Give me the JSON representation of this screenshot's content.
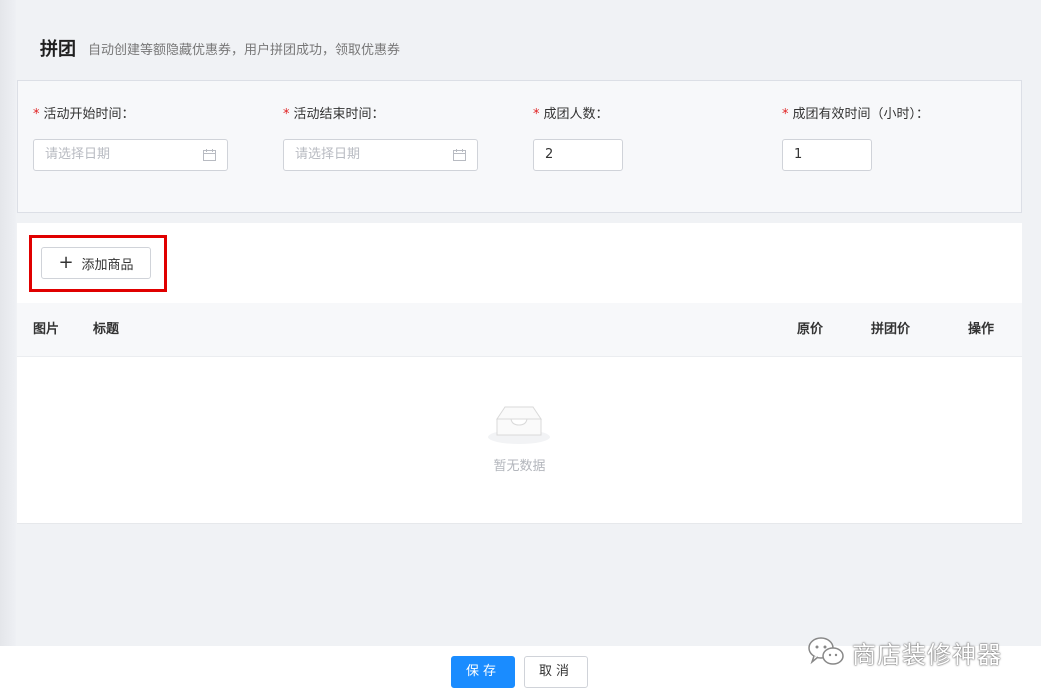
{
  "header": {
    "title": "拼团",
    "description": "自动创建等额隐藏优惠券，用户拼团成功，领取优惠券"
  },
  "form": {
    "required_mark": "*",
    "start_time": {
      "label": "活动开始时间：",
      "placeholder": "请选择日期"
    },
    "end_time": {
      "label": "活动结束时间：",
      "placeholder": "请选择日期"
    },
    "group_size": {
      "label": "成团人数：",
      "value": "2"
    },
    "valid_hours": {
      "label": "成团有效时间（小时）：",
      "value": "1"
    }
  },
  "products": {
    "add_label": "添加商品",
    "columns": {
      "image": "图片",
      "title": "标题",
      "original_price": "原价",
      "group_price": "拼团价",
      "actions": "操作"
    },
    "empty_text": "暂无数据"
  },
  "footer": {
    "save_label": "保存",
    "cancel_label": "取消"
  },
  "watermark": {
    "text": "商店装修神器"
  },
  "colors": {
    "primary": "#1a8cff",
    "required": "#e02020",
    "highlight": "#e00000"
  }
}
